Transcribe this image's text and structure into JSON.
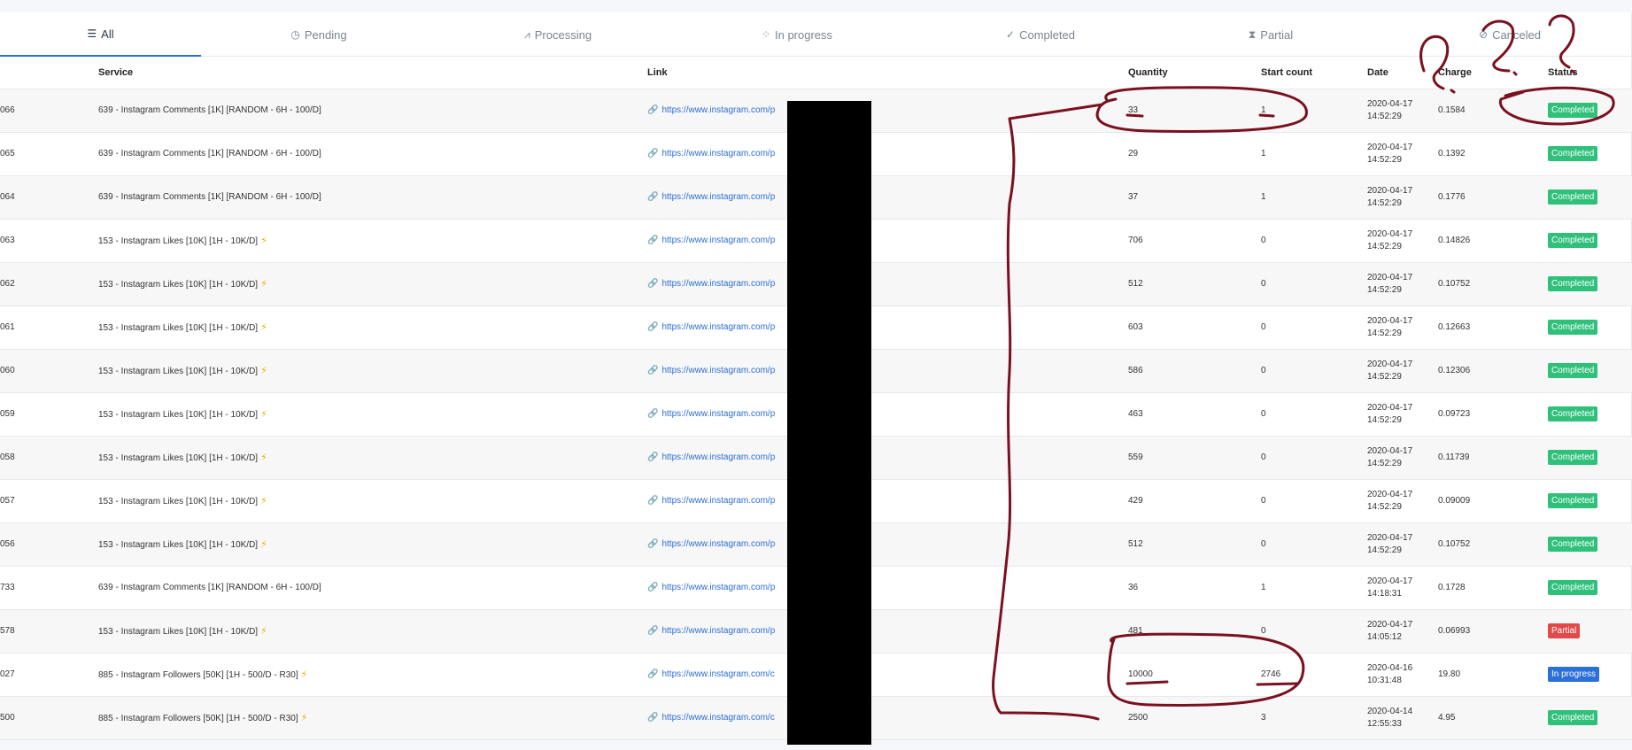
{
  "tabs": [
    {
      "label": "All",
      "icon": "list-icon"
    },
    {
      "label": "Pending",
      "icon": "clock-icon"
    },
    {
      "label": "Processing",
      "icon": "chart-icon"
    },
    {
      "label": "In progress",
      "icon": "spinner-icon"
    },
    {
      "label": "Completed",
      "icon": "check-icon"
    },
    {
      "label": "Partial",
      "icon": "hourglass-icon"
    },
    {
      "label": "Canceled",
      "icon": "ban-icon"
    }
  ],
  "columns": {
    "service": "Service",
    "link": "Link",
    "quantity": "Quantity",
    "start_count": "Start count",
    "date": "Date",
    "charge": "Charge",
    "status": "Status"
  },
  "rows": [
    {
      "id": "066",
      "service": "639 - Instagram Comments [1K] [RANDOM - 6H - 100/D]",
      "link": "https://www.instagram.com/p",
      "quantity": "33",
      "start_count": "1",
      "date": "2020-04-17",
      "time": "14:52:29",
      "charge": "0.1584",
      "status": "Completed"
    },
    {
      "id": "065",
      "service": "639 - Instagram Comments [1K] [RANDOM - 6H - 100/D]",
      "link": "https://www.instagram.com/p",
      "quantity": "29",
      "start_count": "1",
      "date": "2020-04-17",
      "time": "14:52:29",
      "charge": "0.1392",
      "status": "Completed"
    },
    {
      "id": "064",
      "service": "639 - Instagram Comments [1K] [RANDOM - 6H - 100/D]",
      "link": "https://www.instagram.com/p",
      "quantity": "37",
      "start_count": "1",
      "date": "2020-04-17",
      "time": "14:52:29",
      "charge": "0.1776",
      "status": "Completed"
    },
    {
      "id": "063",
      "service": "153 - Instagram Likes [10K] [1H - 10K/D]",
      "link": "https://www.instagram.com/p",
      "quantity": "706",
      "start_count": "0",
      "date": "2020-04-17",
      "time": "14:52:29",
      "charge": "0.14826",
      "status": "Completed"
    },
    {
      "id": "062",
      "service": "153 - Instagram Likes [10K] [1H - 10K/D]",
      "link": "https://www.instagram.com/p",
      "quantity": "512",
      "start_count": "0",
      "date": "2020-04-17",
      "time": "14:52:29",
      "charge": "0.10752",
      "status": "Completed"
    },
    {
      "id": "061",
      "service": "153 - Instagram Likes [10K] [1H - 10K/D]",
      "link": "https://www.instagram.com/p",
      "quantity": "603",
      "start_count": "0",
      "date": "2020-04-17",
      "time": "14:52:29",
      "charge": "0.12663",
      "status": "Completed"
    },
    {
      "id": "060",
      "service": "153 - Instagram Likes [10K] [1H - 10K/D]",
      "link": "https://www.instagram.com/p",
      "quantity": "586",
      "start_count": "0",
      "date": "2020-04-17",
      "time": "14:52:29",
      "charge": "0.12306",
      "status": "Completed"
    },
    {
      "id": "059",
      "service": "153 - Instagram Likes [10K] [1H - 10K/D]",
      "link": "https://www.instagram.com/p",
      "quantity": "463",
      "start_count": "0",
      "date": "2020-04-17",
      "time": "14:52:29",
      "charge": "0.09723",
      "status": "Completed"
    },
    {
      "id": "058",
      "service": "153 - Instagram Likes [10K] [1H - 10K/D]",
      "link": "https://www.instagram.com/p",
      "quantity": "559",
      "start_count": "0",
      "date": "2020-04-17",
      "time": "14:52:29",
      "charge": "0.11739",
      "status": "Completed"
    },
    {
      "id": "057",
      "service": "153 - Instagram Likes [10K] [1H - 10K/D]",
      "link": "https://www.instagram.com/p",
      "quantity": "429",
      "start_count": "0",
      "date": "2020-04-17",
      "time": "14:52:29",
      "charge": "0.09009",
      "status": "Completed"
    },
    {
      "id": "056",
      "service": "153 - Instagram Likes [10K] [1H - 10K/D]",
      "link": "https://www.instagram.com/p",
      "quantity": "512",
      "start_count": "0",
      "date": "2020-04-17",
      "time": "14:52:29",
      "charge": "0.10752",
      "status": "Completed"
    },
    {
      "id": "733",
      "service": "639 - Instagram Comments [1K] [RANDOM - 6H - 100/D]",
      "link": "https://www.instagram.com/p",
      "quantity": "36",
      "start_count": "1",
      "date": "2020-04-17",
      "time": "14:18:31",
      "charge": "0.1728",
      "status": "Completed"
    },
    {
      "id": "578",
      "service": "153 - Instagram Likes [10K] [1H - 10K/D]",
      "link": "https://www.instagram.com/p",
      "quantity": "481",
      "start_count": "0",
      "date": "2020-04-17",
      "time": "14:05:12",
      "charge": "0.06993",
      "status": "Partial"
    },
    {
      "id": "027",
      "service": "885 - Instagram Followers [50K] [1H - 500/D - R30]",
      "link": "https://www.instagram.com/c",
      "quantity": "10000",
      "start_count": "2746",
      "date": "2020-04-16",
      "time": "10:31:48",
      "charge": "19.80",
      "status": "In progress"
    },
    {
      "id": "500",
      "service": "885 - Instagram Followers [50K] [1H - 500/D - R30]",
      "link": "https://www.instagram.com/c",
      "quantity": "2500",
      "start_count": "3",
      "date": "2020-04-14",
      "time": "12:55:33",
      "charge": "4.95",
      "status": "Completed"
    }
  ],
  "colors": {
    "accent": "#2e6dd6",
    "completed": "#2fc07a",
    "partial": "#e24a4a",
    "in_progress": "#2b6fd8",
    "annotation": "#7a1020"
  }
}
